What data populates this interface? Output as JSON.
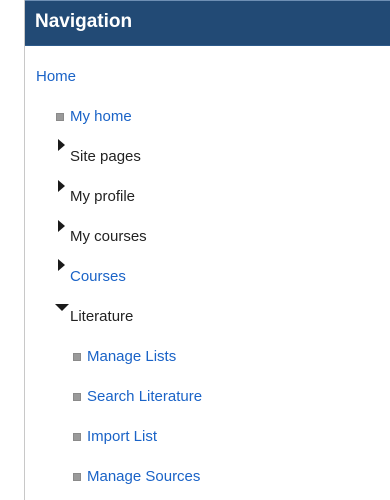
{
  "nav": {
    "title": "Navigation",
    "home": "Home",
    "items": [
      {
        "label": "My home",
        "kind": "link",
        "marker": "bullet-icon"
      },
      {
        "label": "Site pages",
        "kind": "text",
        "marker": "expand-triangle-icon"
      },
      {
        "label": "My profile",
        "kind": "text",
        "marker": "expand-triangle-icon"
      },
      {
        "label": "My courses",
        "kind": "text",
        "marker": "expand-triangle-icon"
      },
      {
        "label": "Courses",
        "kind": "link",
        "marker": "expand-triangle-icon"
      },
      {
        "label": "Literature",
        "kind": "text",
        "marker": "collapse-triangle-icon"
      }
    ],
    "literature_items": [
      {
        "label": "Manage Lists"
      },
      {
        "label": "Search Literature"
      },
      {
        "label": "Import List"
      },
      {
        "label": "Manage Sources"
      }
    ]
  },
  "colors": {
    "header_bg": "#224a75",
    "link": "#1a63c7",
    "text": "#222222"
  }
}
